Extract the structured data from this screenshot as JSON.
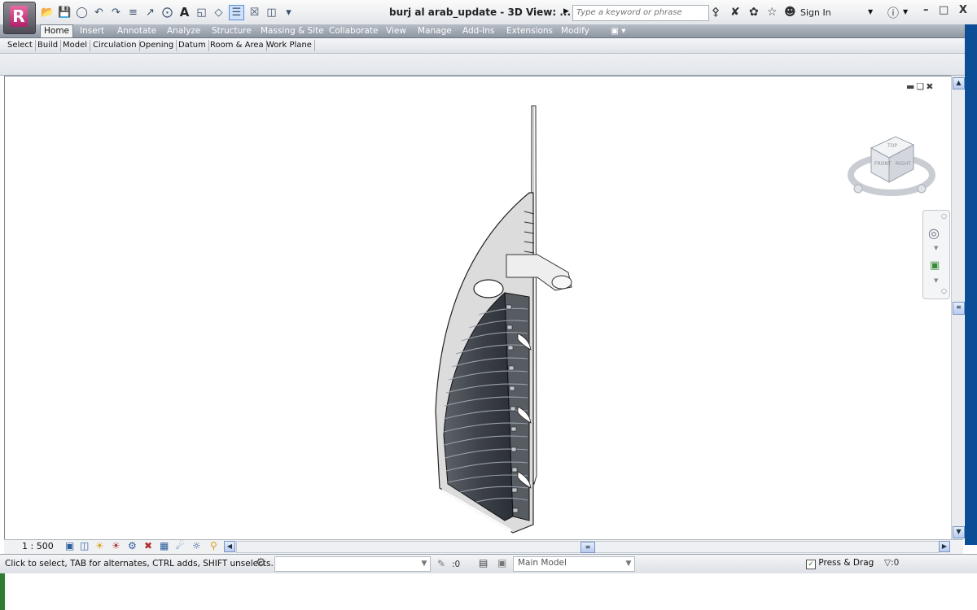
{
  "window": {
    "title": "burj al arab_update - 3D View: ...",
    "search_placeholder": "Type a keyword or phrase",
    "sign_in": "Sign In",
    "controls": "– □ X"
  },
  "ribbon": {
    "tabs": [
      "Home",
      "Insert",
      "Annotate",
      "Analyze",
      "Structure",
      "Massing & Site",
      "Collaborate",
      "View",
      "Manage",
      "Add-Ins",
      "Extensions",
      "Modify"
    ],
    "panels": [
      "Select",
      "Build",
      "Model",
      "Circulation",
      "Opening",
      "Datum",
      "Room & Area",
      "Work Plane"
    ]
  },
  "view": {
    "scale": "1 : 500",
    "viewcube": {
      "top": "TOP",
      "front": "FRONT",
      "right": "RIGHT"
    }
  },
  "status": {
    "message": "Click to select, TAB for alternates, CTRL adds, SHIFT unselects.",
    "worksets_count": ":0",
    "model": "Main Model",
    "press_drag": "Press & Drag",
    "filter_count": ":0",
    "press_drag_checked": true
  },
  "colors": {
    "accent": "#0b4e96",
    "tab_bar": "#9aa3ae"
  }
}
